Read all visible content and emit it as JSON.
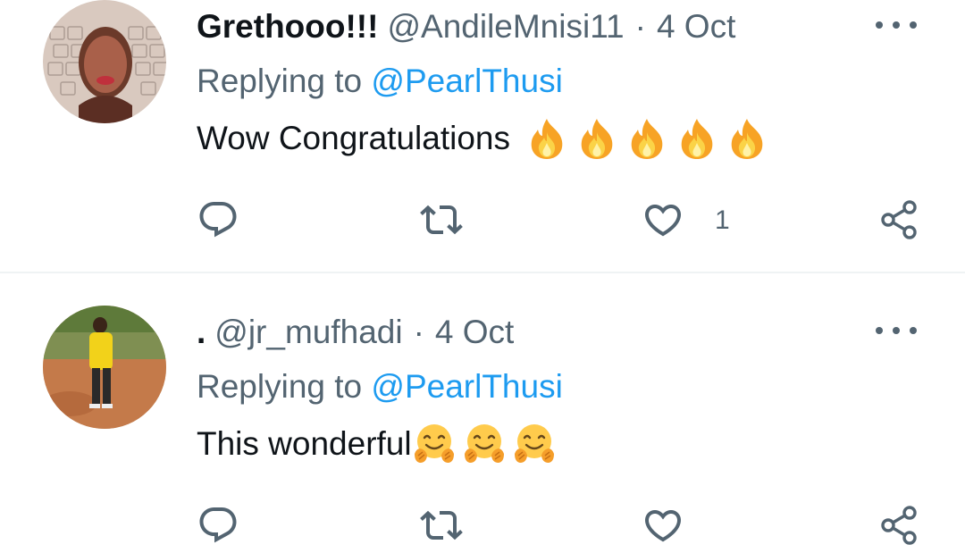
{
  "tweets": [
    {
      "name": "Grethooo!!!",
      "handle": "@AndileMnisi11",
      "separator": "·",
      "date": "4 Oct",
      "replying_prefix": "Replying to ",
      "replying_handle": "@PearlThusi",
      "text": "Wow Congratulations ",
      "emoji": [
        "fire",
        "fire",
        "fire",
        "fire",
        "fire"
      ],
      "actions": {
        "like_count": "1"
      }
    },
    {
      "name": ".",
      "handle": "@jr_mufhadi",
      "separator": "·",
      "date": "4 Oct",
      "replying_prefix": "Replying to ",
      "replying_handle": "@PearlThusi",
      "text": "This wonderful",
      "emoji": [
        "hugging-face",
        "hugging-face",
        "hugging-face"
      ],
      "actions": {
        "like_count": ""
      }
    }
  ],
  "colors": {
    "text": "#0f1419",
    "muted": "#536471",
    "link": "#1d9bf0",
    "divider": "#eff3f4"
  },
  "icons": [
    "reply-icon",
    "retweet-icon",
    "like-icon",
    "share-icon",
    "more-icon"
  ]
}
